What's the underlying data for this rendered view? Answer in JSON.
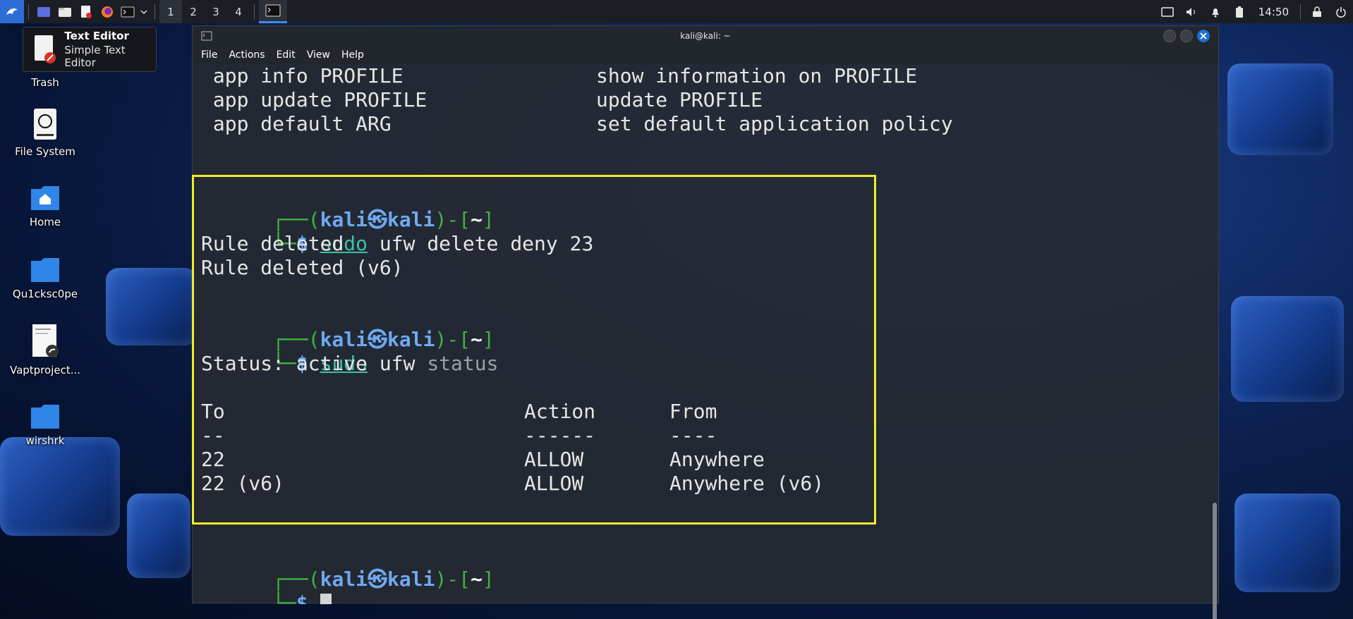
{
  "panel": {
    "workspaces": [
      "1",
      "2",
      "3",
      "4"
    ],
    "active_workspace": "1",
    "clock": "14:50",
    "icons": {
      "menu": "kali-dragon-icon",
      "launchers": [
        "desktop-icon",
        "file-manager-icon",
        "text-editor-icon",
        "firefox-icon",
        "terminal-icon",
        "chevron-down-icon"
      ],
      "tray": [
        "display-icon",
        "volume-icon",
        "notification-bell-icon",
        "battery-icon",
        "lock-icon",
        "power-icon"
      ]
    }
  },
  "tooltip": {
    "title": "Text Editor",
    "subtitle": "Simple Text Editor"
  },
  "desktop": {
    "icons": [
      {
        "label": "Trash",
        "icon": "trash-icon"
      },
      {
        "label": "File System",
        "icon": "drive-icon"
      },
      {
        "label": "Home",
        "icon": "home-folder-icon"
      },
      {
        "label": "Qu1cksc0pe",
        "icon": "folder-icon"
      },
      {
        "label": "Vaptproject...",
        "icon": "document-link-icon"
      },
      {
        "label": "wirshrk",
        "icon": "folder-icon"
      }
    ]
  },
  "window": {
    "title": "kali@kali: ~",
    "menu": [
      "File",
      "Actions",
      "Edit",
      "View",
      "Help"
    ]
  },
  "terminal": {
    "help_lines": [
      {
        "cmd": " app info PROFILE",
        "desc": "show information on PROFILE"
      },
      {
        "cmd": " app update PROFILE",
        "desc": "update PROFILE"
      },
      {
        "cmd": " app default ARG",
        "desc": "set default application policy"
      }
    ],
    "prompt": {
      "user": "kali",
      "at": "㉿",
      "host": "kali",
      "dir": "~",
      "dollar": "$"
    },
    "cmd1": {
      "sudo": "sudo",
      "rest": " ufw delete deny 23"
    },
    "out1": [
      "Rule deleted",
      "Rule deleted (v6)"
    ],
    "cmd2": {
      "sudo": "sudo",
      "ufw": " ufw",
      "rest": " status"
    },
    "status": "Status: active",
    "table": {
      "headers": [
        "To",
        "Action",
        "From"
      ],
      "underlines": [
        "--",
        "------",
        "----"
      ],
      "rows": [
        [
          "22",
          "ALLOW",
          "Anywhere"
        ],
        [
          "22 (v6)",
          "ALLOW",
          "Anywhere (v6)"
        ]
      ]
    }
  },
  "colors": {
    "highlight_box": "#f2ec2a",
    "prompt_blue": "#6fa9f2",
    "prompt_green": "#3fb43f",
    "sudo_teal": "#3fc0a6"
  }
}
